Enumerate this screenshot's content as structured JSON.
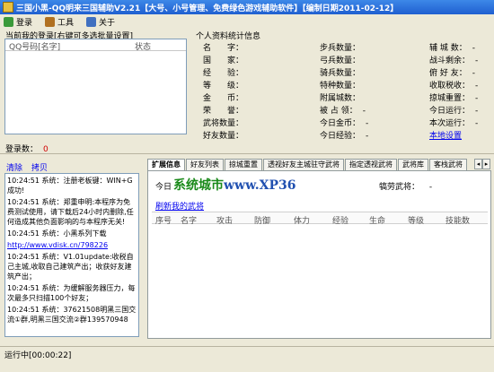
{
  "window": {
    "title": "三国小黑-QQ明来三国辅助V2.21【大号、小号管理、免费绿色游戏辅助软件】【编制日期2011-02-12】"
  },
  "menu": {
    "login": "登录",
    "tools": "工具",
    "about": "关于"
  },
  "login_panel": {
    "caption": "当前我的登录[右键可多选批量设置]",
    "col_qq": "QQ号码[名字]",
    "col_status": "状态",
    "count_label": "登录数：",
    "count_value": "0"
  },
  "profile": {
    "caption": "个人资料统计信息",
    "col1": [
      "名　　字：",
      "国　　家：",
      "经　　验：",
      "等　　级：",
      "金　　币：",
      "荣　　誉：",
      "武将数量：",
      "好友数量："
    ],
    "col2": [
      "步兵数量：",
      "弓兵数量：",
      "骑兵数量：",
      "特种数量：",
      "附属城数：",
      "被 占 领：",
      "今日金币：",
      "今日经验："
    ],
    "col2_values": [
      "",
      "",
      "",
      "",
      "",
      "-",
      "-",
      "-"
    ],
    "col3": [
      "辅 城 数：",
      "战斗剩余：",
      "俯 好 友：",
      "收取税收：",
      "掠城重置：",
      "今日运行：",
      "本次运行："
    ],
    "col3_values": [
      "-",
      "-",
      "-",
      "-",
      "-",
      "-",
      "-"
    ],
    "settings_link": "本地设置"
  },
  "log_panel": {
    "clear": "清除",
    "copy": "拷贝",
    "lines": [
      "10:24:51 系统：注册老板键：WIN+G 成功!",
      "10:24:51 系统：郑重申明:本程序为免费测试使用，请下载后24小时内删除,任何造成其他负面影响的与本程序无关!",
      "10:24:51 系统：小黑系列下载",
      "http://www.vdisk.cn/798226",
      "10:24:51 系统：V1.01update:收税自己主城,收取自己建筑产出；收获好友建筑产出；",
      "10:24:51 系统：为缓解服务器压力，每次最多只扫描100个好友；",
      "10:24:51 系统：37621508明黑三国交流①群,明黑三国交流②群139570948"
    ]
  },
  "tabs": [
    "扩展信息",
    "好友列表",
    "掠城重置",
    "透视好友主城驻守武将",
    "指定透视武将",
    "武将库",
    "客栈武将"
  ],
  "detail": {
    "today_label": "今日",
    "today_value": "-",
    "watermark_cn": "系统城市",
    "watermark_domain": "www.XP36",
    "reward_label": "犒劳武将：",
    "reward_value": "-",
    "refresh_link": "刷新我的武将",
    "columns": [
      "序号",
      "名字",
      "攻击",
      "防御",
      "体力",
      "经验",
      "生命",
      "等级",
      "技能数"
    ]
  },
  "statusbar": {
    "text": "运行中[00:00:22]"
  }
}
